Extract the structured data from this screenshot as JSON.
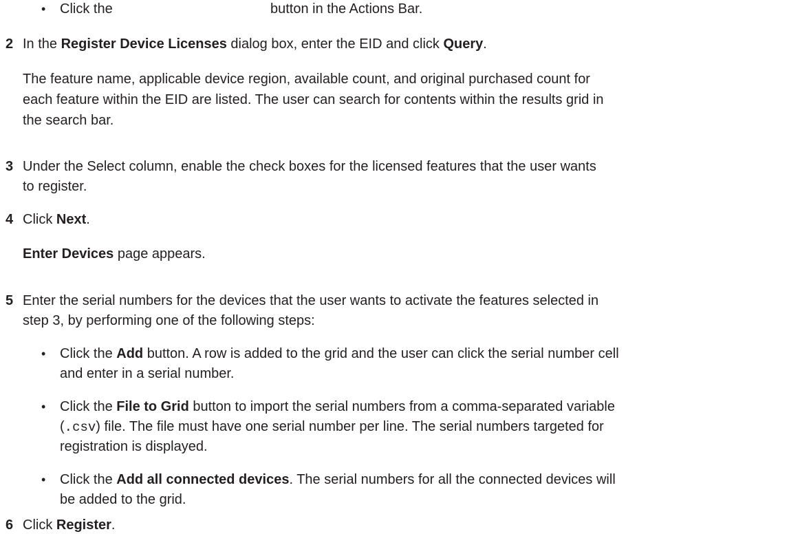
{
  "bullet_glyph": "•",
  "top_bullet": {
    "pre": "Click the",
    "post": "button in the Actions Bar."
  },
  "steps": [
    {
      "number": "2",
      "parts": [
        "In the ",
        "Register Device Licenses",
        " dialog box, enter the EID and click ",
        "Query",
        "."
      ],
      "note_lines": [
        "The feature name, applicable device region, available count, and original purchased count for",
        "each feature within the EID are listed. The user can search for contents within the results grid in",
        "the search bar."
      ]
    },
    {
      "number": "3",
      "lines": [
        "Under the Select column, enable the check boxes for the licensed features that the user wants",
        "to register."
      ]
    },
    {
      "number": "4",
      "parts": [
        "Click ",
        "Next",
        "."
      ],
      "result": [
        "Enter Devices",
        " page appears."
      ]
    },
    {
      "number": "5",
      "lines": [
        "Enter the serial numbers for the devices that the user wants to activate the features selected in",
        "step 3, by performing one of the following steps:"
      ],
      "bullets": [
        {
          "line1": [
            "Click the ",
            "Add",
            " button. A row is added to the grid and the user can click the serial number cell"
          ],
          "line2": "and enter in a serial number."
        },
        {
          "line1": [
            "Click the ",
            "File to Grid",
            " button to import the serial numbers from a comma-separated variable"
          ],
          "line2": [
            "(",
            ".csv",
            ") file. The file must have one serial number per line. The serial numbers targeted for"
          ],
          "line3": "registration is displayed."
        },
        {
          "line1": [
            "Click the ",
            "Add all connected devices",
            ". The serial numbers for all the connected devices will"
          ],
          "line2": "be added to the grid."
        }
      ]
    },
    {
      "number": "6",
      "parts": [
        "Click ",
        "Register",
        "."
      ]
    }
  ]
}
